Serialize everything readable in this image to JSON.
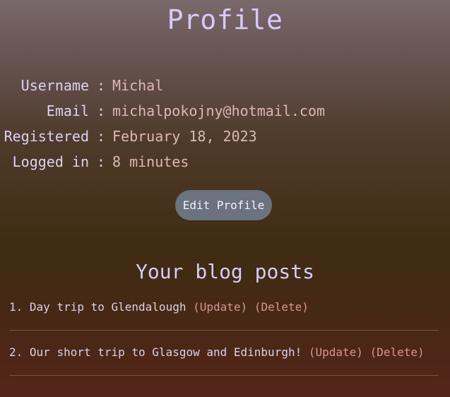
{
  "page": {
    "title": "Profile"
  },
  "profile": {
    "fields": [
      {
        "label": "Username",
        "value": "Michal"
      },
      {
        "label": "Email",
        "value": "michalpokojny@hotmail.com"
      },
      {
        "label": "Registered",
        "value": "February 18, 2023"
      },
      {
        "label": "Logged in",
        "value": "8 minutes"
      }
    ],
    "separator": ":",
    "edit_button": "Edit Profile"
  },
  "posts": {
    "heading": "Your blog posts",
    "items": [
      {
        "prefix": "1.",
        "title": "Day trip to Glendalough",
        "update": "(Update)",
        "delete": "(Delete)"
      },
      {
        "prefix": "2.",
        "title": "Our short trip to Glasgow and Edinburgh!",
        "update": "(Update)",
        "delete": "(Delete)"
      }
    ]
  },
  "colors": {
    "title": "#d7c9ff",
    "value_text": "#ddb7b7",
    "action_link": "#d79595",
    "button_bg": "#6b7280"
  }
}
